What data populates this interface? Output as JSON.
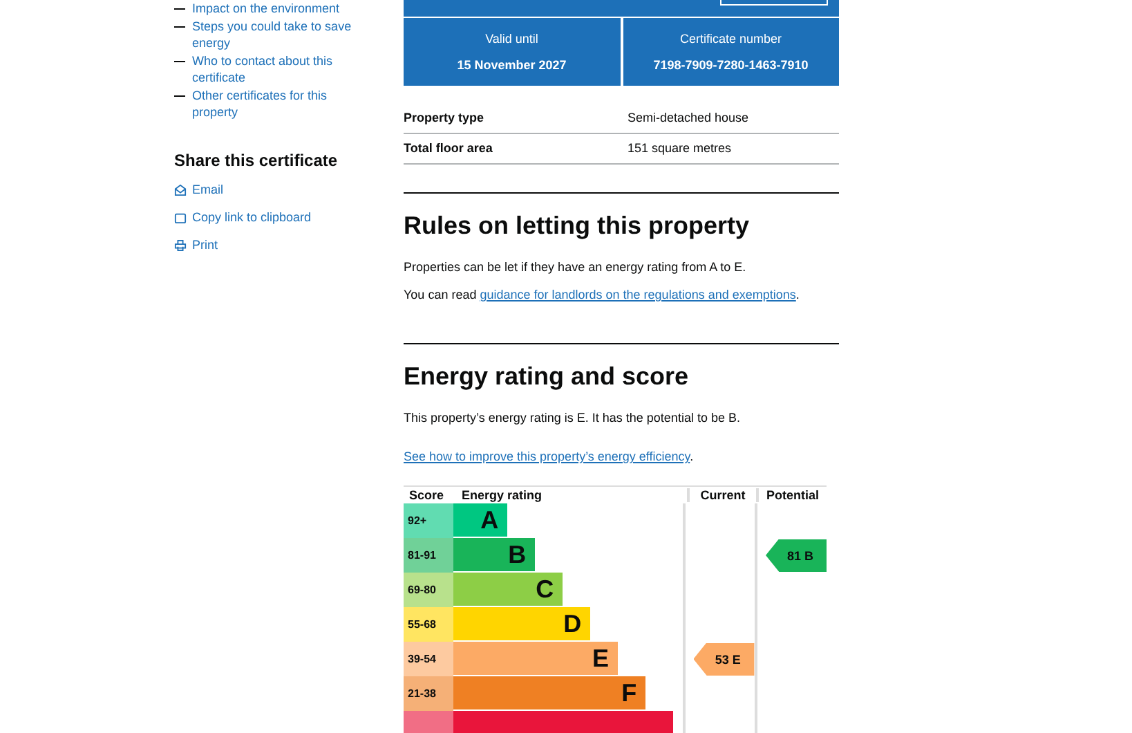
{
  "sidebar": {
    "contents": [
      "Impact on the environment",
      "Steps you could take to save energy",
      "Who to contact about this certificate",
      "Other certificates for this property"
    ],
    "share_heading": "Share this certificate",
    "share_links": [
      {
        "kind": "email",
        "label": "Email"
      },
      {
        "kind": "copy",
        "label": "Copy link to clipboard"
      },
      {
        "kind": "print",
        "label": "Print"
      }
    ]
  },
  "certificate": {
    "cells": [
      {
        "label": "Valid until",
        "value": "15 November 2027"
      },
      {
        "label": "Certificate number",
        "value": "7198-7909-7280-1463-7910"
      }
    ]
  },
  "summary": [
    {
      "key": "Property type",
      "value": "Semi-detached house"
    },
    {
      "key": "Total floor area",
      "value": "151 square metres"
    }
  ],
  "letting": {
    "heading": "Rules on letting this property",
    "text": "Properties can be let if they have an energy rating from A to E.",
    "link_prefix": "You can read ",
    "link": "guidance for landlords on the regulations and exemptions",
    "link_suffix": "."
  },
  "energy": {
    "heading": "Energy rating and score",
    "text": "This property’s energy rating is E. It has the potential to be B.",
    "link": "See how to improve this property’s energy efficiency",
    "link_suffix": ".",
    "columns": [
      "Score",
      "Energy rating",
      "Current",
      "Potential"
    ],
    "bands": [
      {
        "score": "92+",
        "letter": "A",
        "color": "#00c781"
      },
      {
        "score": "81-91",
        "letter": "B",
        "color": "#19b459",
        "potential": "81 B"
      },
      {
        "score": "69-80",
        "letter": "C",
        "color": "#8dce46"
      },
      {
        "score": "55-68",
        "letter": "D",
        "color": "#ffd500"
      },
      {
        "score": "39-54",
        "letter": "E",
        "color": "#fcaa65",
        "current": "53 E"
      },
      {
        "score": "21-38",
        "letter": "F",
        "color": "#ef8023"
      },
      {
        "color": "#e9153b"
      }
    ]
  }
}
